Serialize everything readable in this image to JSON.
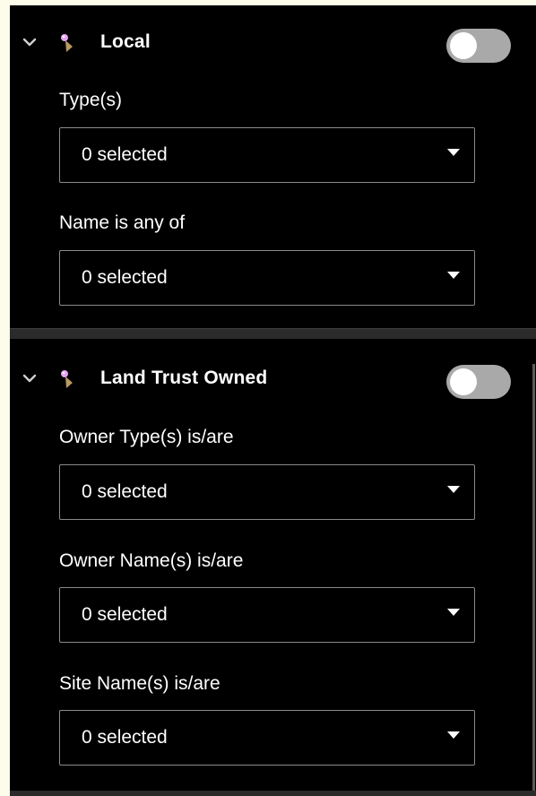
{
  "colors": {
    "page_background": "#fdfbe9",
    "panel_background": "#000000",
    "text": "#ffffff",
    "toggle_track_off": "#a9a9a9",
    "field_border": "#8a8a8a",
    "pin_head": "#e6a2f5",
    "pin_stem": "#b89a63"
  },
  "sections": [
    {
      "title": "Local",
      "expanded": true,
      "enabled": false,
      "icons": [
        "chevron-down-icon",
        "map-pin-icon"
      ],
      "fields": [
        {
          "label": "Type(s)",
          "value": "0 selected"
        },
        {
          "label": "Name is any of",
          "value": "0 selected"
        }
      ]
    },
    {
      "title": "Land Trust Owned",
      "expanded": true,
      "enabled": false,
      "icons": [
        "chevron-down-icon",
        "map-pin-icon"
      ],
      "fields": [
        {
          "label": "Owner Type(s) is/are",
          "value": "0 selected"
        },
        {
          "label": "Owner Name(s) is/are",
          "value": "0 selected"
        },
        {
          "label": "Site Name(s) is/are",
          "value": "0 selected"
        }
      ]
    }
  ]
}
